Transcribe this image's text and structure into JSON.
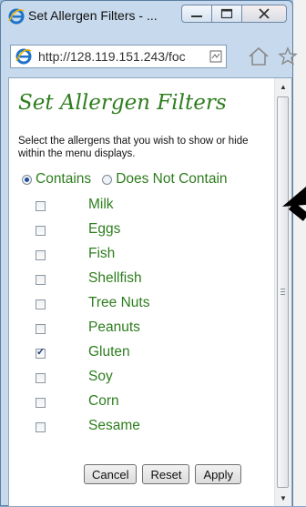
{
  "window": {
    "title": "Set Allergen Filters - ...",
    "url": "http://128.119.151.243/foc"
  },
  "panel": {
    "heading": "Set Allergen Filters",
    "instructions": "Select the allergens that you wish to show or hide within the menu displays.",
    "mode_options": [
      {
        "label": "Contains",
        "selected": true
      },
      {
        "label": "Does Not Contain",
        "selected": false
      }
    ],
    "allergens": [
      {
        "label": "Milk",
        "checked": false
      },
      {
        "label": "Eggs",
        "checked": false
      },
      {
        "label": "Fish",
        "checked": false
      },
      {
        "label": "Shellfish",
        "checked": false
      },
      {
        "label": "Tree Nuts",
        "checked": false
      },
      {
        "label": "Peanuts",
        "checked": false
      },
      {
        "label": "Gluten",
        "checked": true
      },
      {
        "label": "Soy",
        "checked": false
      },
      {
        "label": "Corn",
        "checked": false
      },
      {
        "label": "Sesame",
        "checked": false
      }
    ],
    "buttons": {
      "cancel": "Cancel",
      "reset": "Reset",
      "apply": "Apply"
    }
  },
  "colors": {
    "label_green": "#2e7d1e",
    "window_frame": "#c7d9ec"
  }
}
